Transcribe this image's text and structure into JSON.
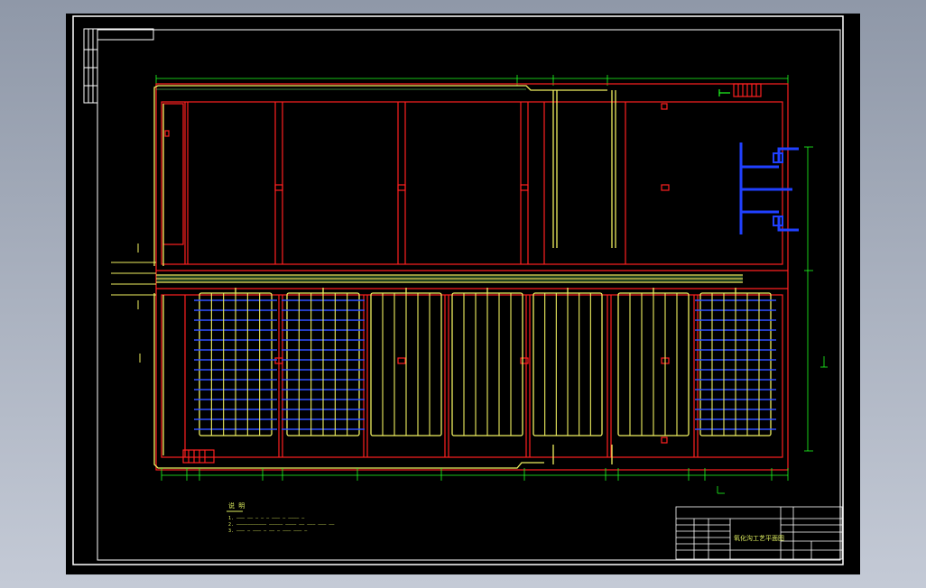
{
  "colors": {
    "background": "#000000",
    "frame": "#ffffff",
    "wall": "#ff2020",
    "pipe": "#f0f060",
    "pipe_inner": "#80ff80",
    "dimension": "#20ff20",
    "air_pipe": "#3050ff",
    "pump": "#2040ff"
  },
  "icons": {
    "north_marker": "north-arrow-icon",
    "pump_assembly": "pump-assembly-icon"
  },
  "notes": {
    "heading": "说 明",
    "line1": "1. ——— —— — — — ——— — ———— —",
    "line2": "2. ——————————— ————— ———— —— ——— ——— ——",
    "line3": "3. ——— — ——— — —— — ——— ——— —"
  },
  "title_block": {
    "drawing_title": "氧化沟工艺平面图"
  }
}
